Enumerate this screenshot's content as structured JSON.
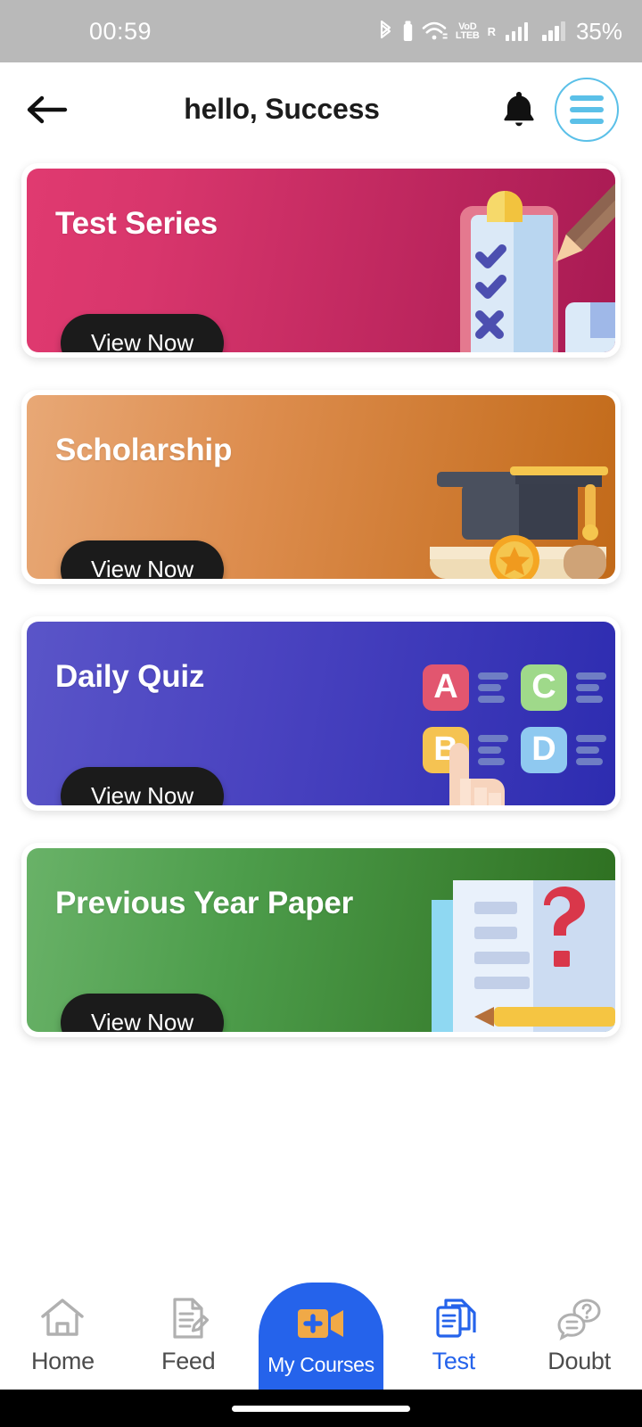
{
  "status_bar": {
    "time": "00:59",
    "battery_percent": "35%",
    "icons": [
      "bluetooth-icon",
      "bluetooth-device-battery-icon",
      "wifi-icon",
      "volte-icon",
      "signal-roaming-icon",
      "signal-icon"
    ],
    "volte_top": "VoD",
    "volte_bottom": "LTEB",
    "roaming_label": "R",
    "background": "#b9b9b9"
  },
  "header": {
    "title": "hello, Success",
    "back_icon": "back-arrow-icon",
    "bell_icon": "bell-icon",
    "menu_icon": "hamburger-menu-icon",
    "accent": "#5bc0e8"
  },
  "cards": [
    {
      "title": "Test Series",
      "button": "View Now",
      "illustration": "clipboard-checklist-icon",
      "gradient_from": "#e03a70",
      "gradient_to": "#a81a53"
    },
    {
      "title": "Scholarship",
      "button": "View Now",
      "illustration": "graduation-cap-diploma-icon",
      "gradient_from": "#e8a876",
      "gradient_to": "#c26a19"
    },
    {
      "title": "Daily Quiz",
      "button": "View Now",
      "illustration": "quiz-options-icon",
      "options": [
        "A",
        "B",
        "C",
        "D"
      ],
      "option_colors": [
        "#e2566f",
        "#f5c352",
        "#9fd98a",
        "#8fc9f0"
      ],
      "gradient_from": "#5a55c8",
      "gradient_to": "#2d2cb0"
    },
    {
      "title": "Previous Year Paper",
      "button": "View Now",
      "illustration": "question-paper-icon",
      "gradient_from": "#69b268",
      "gradient_to": "#2d6e1f"
    }
  ],
  "bottom_nav": {
    "items": [
      {
        "label": "Home",
        "icon": "home-icon",
        "active": false
      },
      {
        "label": "Feed",
        "icon": "feed-document-icon",
        "active": false
      },
      {
        "label": "My Courses",
        "icon": "video-camera-icon",
        "active": true
      },
      {
        "label": "Test",
        "icon": "documents-stack-icon",
        "active": false
      },
      {
        "label": "Doubt",
        "icon": "question-chat-icon",
        "active": false
      }
    ],
    "active_color": "#2563eb",
    "inactive_color": "#9a9a9a"
  }
}
